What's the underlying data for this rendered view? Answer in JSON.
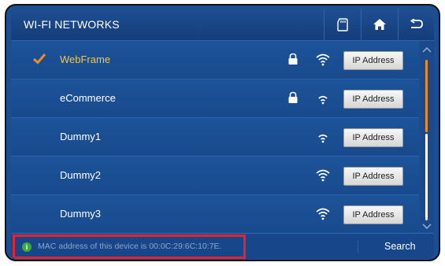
{
  "header": {
    "title": "WI-FI NETWORKS",
    "buttons": [
      {
        "icon": "sd-card-icon"
      },
      {
        "icon": "home-icon"
      },
      {
        "icon": "back-arrow-icon"
      }
    ]
  },
  "networks": [
    {
      "ssid": "WebFrame",
      "selected": true,
      "locked": true,
      "ip_label": "IP Address"
    },
    {
      "ssid": "eCommerce",
      "selected": false,
      "locked": true,
      "ip_label": "IP Address"
    },
    {
      "ssid": "Dummy1",
      "selected": false,
      "locked": false,
      "ip_label": "IP Address"
    },
    {
      "ssid": "Dummy2",
      "selected": false,
      "locked": false,
      "ip_label": "IP Address"
    },
    {
      "ssid": "Dummy3",
      "selected": false,
      "locked": false,
      "ip_label": "IP Address"
    }
  ],
  "footer": {
    "info_glyph": "i",
    "mac_text": "MAC address of this device is 00:0C:29:6C:10:7E.",
    "search_label": "Search"
  },
  "colors": {
    "background": "#1c4f94",
    "selected_text": "#f6c445",
    "check": "#f08a24",
    "scroll_thumb": "#f08a24",
    "highlight_box": "#e8212b",
    "info_icon": "#3dab3a"
  }
}
